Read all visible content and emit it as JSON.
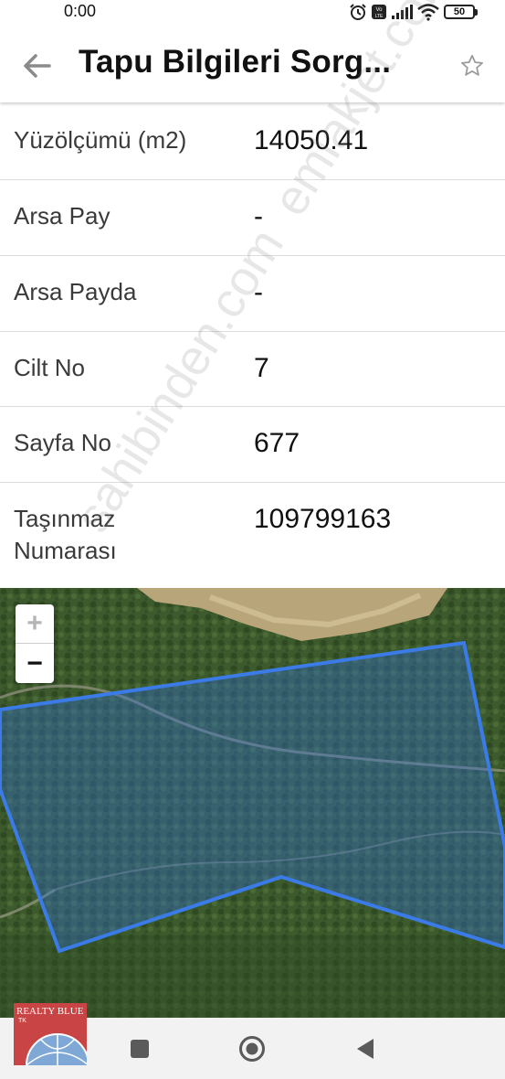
{
  "status_bar": {
    "time": "0:00",
    "battery": "50",
    "icons": [
      "alarm-icon",
      "volte-icon",
      "signal-icon",
      "wifi-icon",
      "battery-icon"
    ]
  },
  "header": {
    "title": "Tapu Bilgileri Sorg...",
    "back_icon": "arrow-left-icon",
    "favorite_icon": "star-outline-icon"
  },
  "details": [
    {
      "label": "Yüzölçümü (m2)",
      "value": "14050.41"
    },
    {
      "label": "Arsa Pay",
      "value": "-"
    },
    {
      "label": "Arsa Payda",
      "value": "-"
    },
    {
      "label": "Cilt No",
      "value": "7"
    },
    {
      "label": "Sayfa No",
      "value": "677"
    },
    {
      "label": "Taşınmaz Numarası",
      "value": "109799163"
    }
  ],
  "map": {
    "zoom_in": "+",
    "zoom_out": "−",
    "parcel_stroke_color": "#3b7be8",
    "parcel_fill_color": "#2f6fd8"
  },
  "watermark": "sahibinden.com emlakjet.com",
  "logo": {
    "text": "REALTY BLUE",
    "sub": "TK"
  },
  "nav_bar": {
    "buttons": [
      "recents-icon",
      "home-icon",
      "back-triangle-icon"
    ]
  }
}
